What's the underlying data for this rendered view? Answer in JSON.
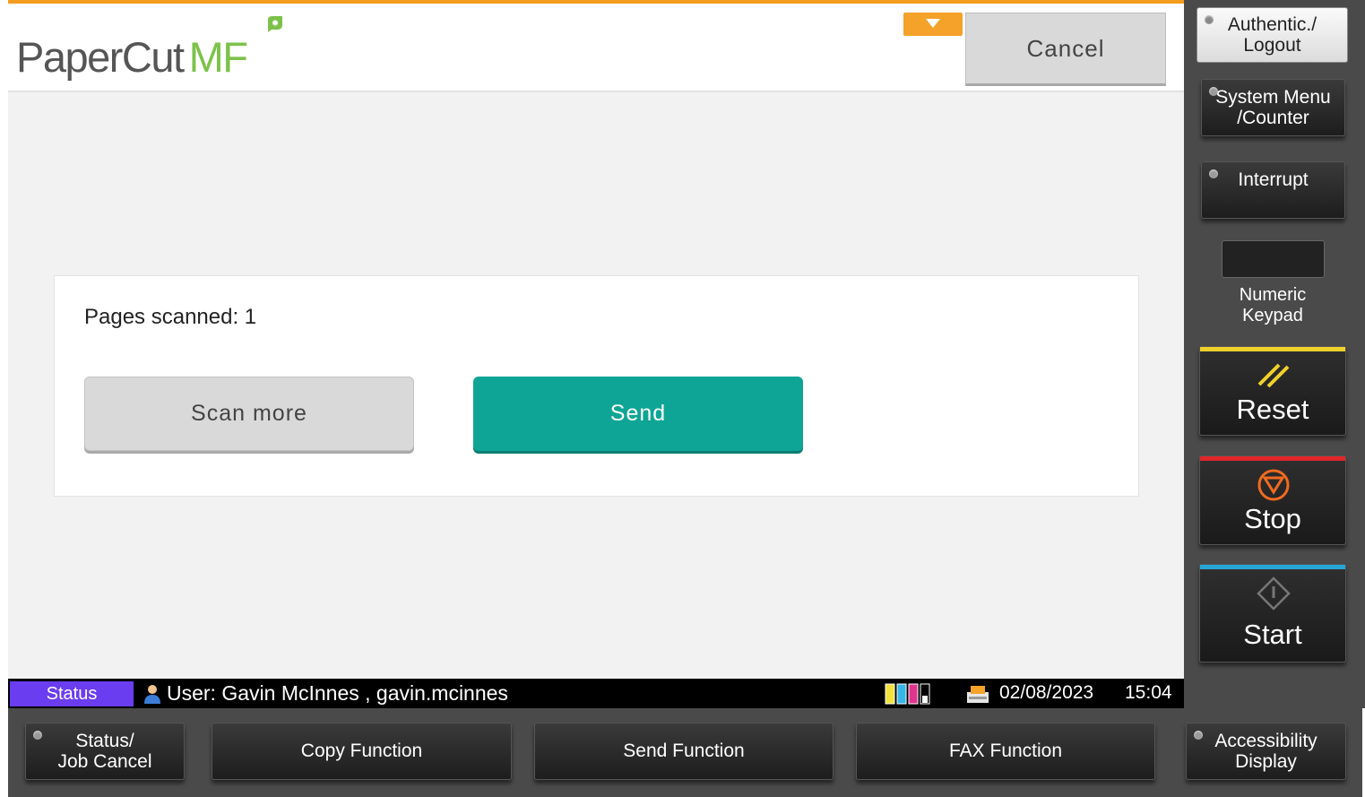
{
  "header": {
    "logo_text": "PaperCut",
    "logo_suffix": "MF",
    "cancel_label": "Cancel"
  },
  "main": {
    "pages_scanned_text": "Pages scanned: 1",
    "scan_more_label": "Scan more",
    "send_label": "Send"
  },
  "status_bar": {
    "status_label": "Status",
    "user_text": "User: Gavin McInnes , gavin.mcinnes",
    "date": "02/08/2023",
    "time": "15:04"
  },
  "side_panel": {
    "auth_label": "Authentic./\nLogout",
    "system_menu_label": "System Menu\n/Counter",
    "interrupt_label": "Interrupt",
    "numeric_keypad_label": "Numeric\nKeypad",
    "reset_label": "Reset",
    "stop_label": "Stop",
    "start_label": "Start"
  },
  "bottom_bar": {
    "status_job_cancel_label": "Status/\nJob Cancel",
    "copy_function_label": "Copy Function",
    "send_function_label": "Send Function",
    "fax_function_label": "FAX Function",
    "accessibility_label": "Accessibility\nDisplay"
  },
  "colors": {
    "accent_orange": "#f39c1f",
    "send_teal": "#0fa596",
    "status_purple": "#6a3df0",
    "logo_green": "#7cc24a",
    "reset_yellow": "#f1d12a",
    "stop_red": "#e0262a",
    "start_blue": "#27a6d6"
  }
}
